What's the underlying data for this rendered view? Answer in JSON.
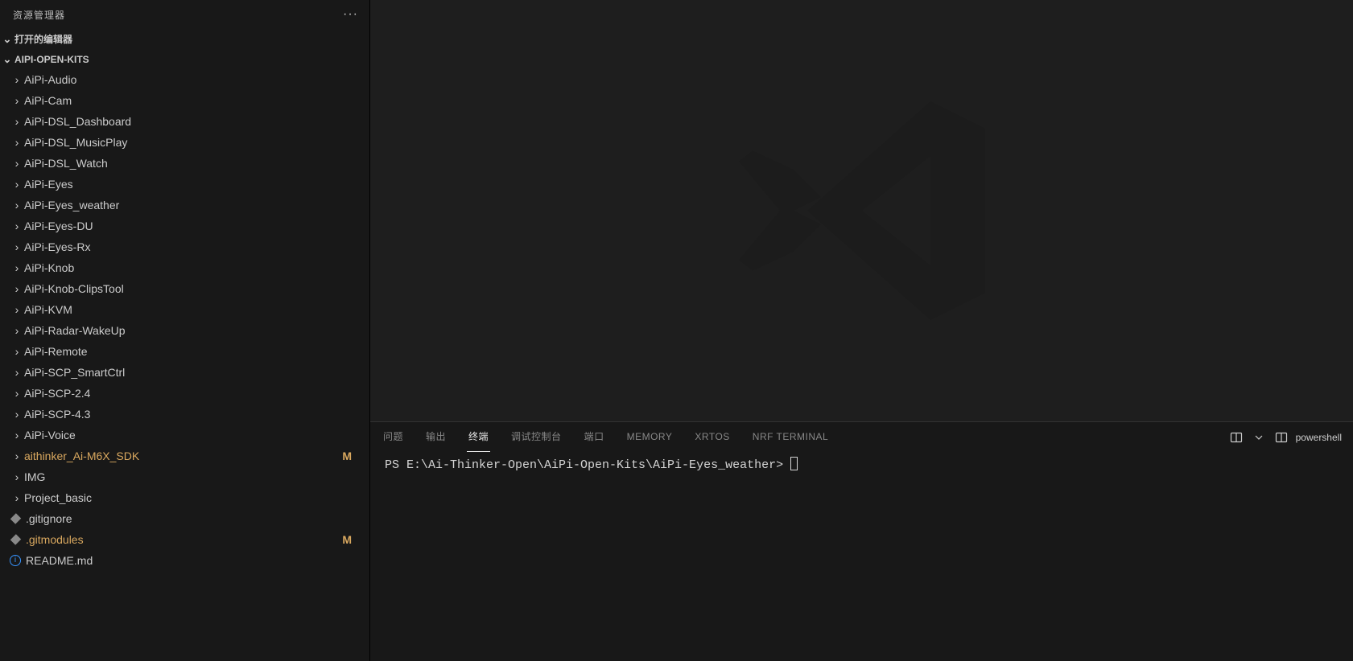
{
  "sidebar": {
    "title": "资源管理器",
    "open_editors_label": "打开的编辑器",
    "project_name": "AIPI-OPEN-KITS",
    "tree": [
      {
        "name": "AiPi-Audio",
        "type": "folder"
      },
      {
        "name": "AiPi-Cam",
        "type": "folder"
      },
      {
        "name": "AiPi-DSL_Dashboard",
        "type": "folder"
      },
      {
        "name": "AiPi-DSL_MusicPlay",
        "type": "folder"
      },
      {
        "name": "AiPi-DSL_Watch",
        "type": "folder"
      },
      {
        "name": "AiPi-Eyes",
        "type": "folder"
      },
      {
        "name": "AiPi-Eyes_weather",
        "type": "folder"
      },
      {
        "name": "AiPi-Eyes-DU",
        "type": "folder"
      },
      {
        "name": "AiPi-Eyes-Rx",
        "type": "folder"
      },
      {
        "name": "AiPi-Knob",
        "type": "folder"
      },
      {
        "name": "AiPi-Knob-ClipsTool",
        "type": "folder"
      },
      {
        "name": "AiPi-KVM",
        "type": "folder"
      },
      {
        "name": "AiPi-Radar-WakeUp",
        "type": "folder"
      },
      {
        "name": "AiPi-Remote",
        "type": "folder"
      },
      {
        "name": "AiPi-SCP_SmartCtrl",
        "type": "folder"
      },
      {
        "name": "AiPi-SCP-2.4",
        "type": "folder"
      },
      {
        "name": "AiPi-SCP-4.3",
        "type": "folder"
      },
      {
        "name": "AiPi-Voice",
        "type": "folder"
      },
      {
        "name": "aithinker_Ai-M6X_SDK",
        "type": "folder",
        "modified": true,
        "decor": "M"
      },
      {
        "name": "IMG",
        "type": "folder"
      },
      {
        "name": "Project_basic",
        "type": "folder"
      },
      {
        "name": ".gitignore",
        "type": "file",
        "icon": "diamond"
      },
      {
        "name": ".gitmodules",
        "type": "file",
        "icon": "diamond",
        "modified": true,
        "decor": "M"
      },
      {
        "name": "README.md",
        "type": "file",
        "icon": "info"
      }
    ]
  },
  "panel": {
    "tabs": [
      "问题",
      "输出",
      "终端",
      "调试控制台",
      "端口",
      "MEMORY",
      "XRTOS",
      "NRF TERMINAL"
    ],
    "active_tab": 2,
    "shell_name": "powershell",
    "terminal_prompt": "PS E:\\Ai-Thinker-Open\\AiPi-Open-Kits\\AiPi-Eyes_weather> "
  }
}
